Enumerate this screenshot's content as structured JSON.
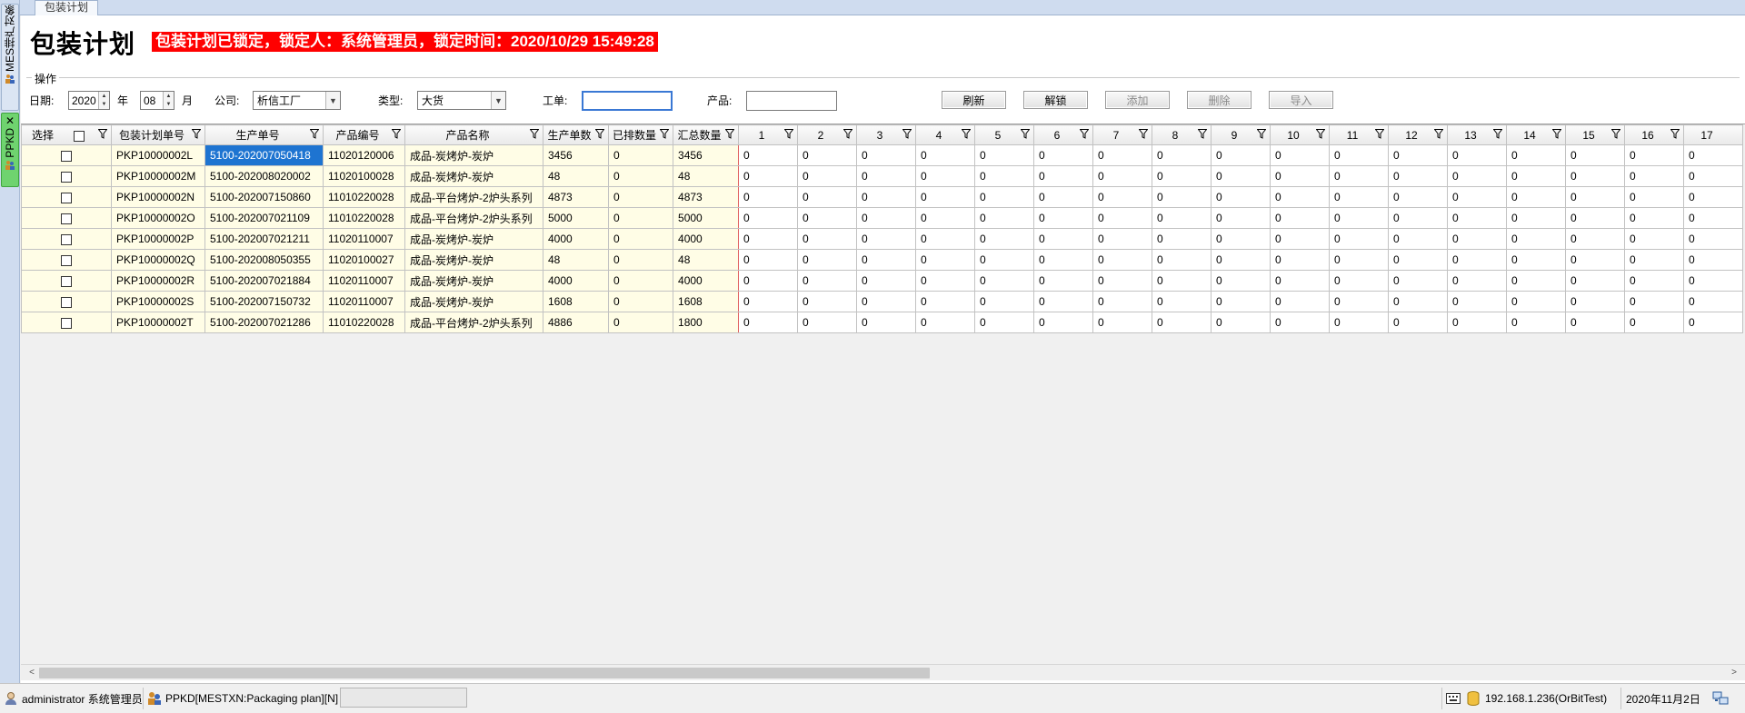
{
  "window": {
    "doc_tab": "包装计划",
    "left_tabs": [
      "MES排产对象",
      "PPKD"
    ]
  },
  "header": {
    "title": "包装计划",
    "lock_message": "包装计划已锁定，锁定人：系统管理员，锁定时间：2020/10/29 15:49:28"
  },
  "ops": {
    "group_label": "操作",
    "date_label": "日期:",
    "year_value": "2020",
    "year_unit": "年",
    "month_value": "08",
    "month_unit": "月",
    "company_label": "公司:",
    "company_value": "析信工厂",
    "type_label": "类型:",
    "type_value": "大货",
    "workorder_label": "工单:",
    "workorder_value": "",
    "product_label": "产品:",
    "product_value": "",
    "buttons": {
      "refresh": "刷新",
      "unlock": "解锁",
      "add": "添加",
      "delete": "删除",
      "import": "导入"
    }
  },
  "grid": {
    "columns": [
      "选择",
      "包装计划单号",
      "生产单号",
      "产品编号",
      "产品名称",
      "生产单数",
      "已排数量",
      "汇总数量",
      "1",
      "2",
      "3",
      "4",
      "5",
      "6",
      "7",
      "8",
      "9",
      "10",
      "11",
      "12",
      "13",
      "14",
      "15",
      "16",
      "17"
    ],
    "rows": [
      {
        "plan": "PKP10000002L",
        "order": "5100-202007050418",
        "code": "11020120006",
        "name": "成品-炭烤炉-炭炉",
        "qty": "3456",
        "scheduled": "0",
        "total": "3456",
        "days": [
          "0",
          "0",
          "0",
          "0",
          "0",
          "0",
          "0",
          "0",
          "0",
          "0",
          "0",
          "0",
          "0",
          "0",
          "0",
          "0",
          "0"
        ]
      },
      {
        "plan": "PKP10000002M",
        "order": "5100-202008020002",
        "code": "11020100028",
        "name": "成品-炭烤炉-炭炉",
        "qty": "48",
        "scheduled": "0",
        "total": "48",
        "days": [
          "0",
          "0",
          "0",
          "0",
          "0",
          "0",
          "0",
          "0",
          "0",
          "0",
          "0",
          "0",
          "0",
          "0",
          "0",
          "0",
          "0"
        ]
      },
      {
        "plan": "PKP10000002N",
        "order": "5100-202007150860",
        "code": "11010220028",
        "name": "成品-平台烤炉-2炉头系列",
        "qty": "4873",
        "scheduled": "0",
        "total": "4873",
        "days": [
          "0",
          "0",
          "0",
          "0",
          "0",
          "0",
          "0",
          "0",
          "0",
          "0",
          "0",
          "0",
          "0",
          "0",
          "0",
          "0",
          "0"
        ]
      },
      {
        "plan": "PKP10000002O",
        "order": "5100-202007021109",
        "code": "11010220028",
        "name": "成品-平台烤炉-2炉头系列",
        "qty": "5000",
        "scheduled": "0",
        "total": "5000",
        "days": [
          "0",
          "0",
          "0",
          "0",
          "0",
          "0",
          "0",
          "0",
          "0",
          "0",
          "0",
          "0",
          "0",
          "0",
          "0",
          "0",
          "0"
        ]
      },
      {
        "plan": "PKP10000002P",
        "order": "5100-202007021211",
        "code": "11020110007",
        "name": "成品-炭烤炉-炭炉",
        "qty": "4000",
        "scheduled": "0",
        "total": "4000",
        "days": [
          "0",
          "0",
          "0",
          "0",
          "0",
          "0",
          "0",
          "0",
          "0",
          "0",
          "0",
          "0",
          "0",
          "0",
          "0",
          "0",
          "0"
        ]
      },
      {
        "plan": "PKP10000002Q",
        "order": "5100-202008050355",
        "code": "11020100027",
        "name": "成品-炭烤炉-炭炉",
        "qty": "48",
        "scheduled": "0",
        "total": "48",
        "days": [
          "0",
          "0",
          "0",
          "0",
          "0",
          "0",
          "0",
          "0",
          "0",
          "0",
          "0",
          "0",
          "0",
          "0",
          "0",
          "0",
          "0"
        ]
      },
      {
        "plan": "PKP10000002R",
        "order": "5100-202007021884",
        "code": "11020110007",
        "name": "成品-炭烤炉-炭炉",
        "qty": "4000",
        "scheduled": "0",
        "total": "4000",
        "days": [
          "0",
          "0",
          "0",
          "0",
          "0",
          "0",
          "0",
          "0",
          "0",
          "0",
          "0",
          "0",
          "0",
          "0",
          "0",
          "0",
          "0"
        ]
      },
      {
        "plan": "PKP10000002S",
        "order": "5100-202007150732",
        "code": "11020110007",
        "name": "成品-炭烤炉-炭炉",
        "qty": "1608",
        "scheduled": "0",
        "total": "1608",
        "days": [
          "0",
          "0",
          "0",
          "0",
          "0",
          "0",
          "0",
          "0",
          "0",
          "0",
          "0",
          "0",
          "0",
          "0",
          "0",
          "0",
          "0"
        ]
      },
      {
        "plan": "PKP10000002T",
        "order": "5100-202007021286",
        "code": "11010220028",
        "name": "成品-平台烤炉-2炉头系列",
        "qty": "4886",
        "scheduled": "0",
        "total": "1800",
        "days": [
          "0",
          "0",
          "0",
          "0",
          "0",
          "0",
          "0",
          "0",
          "0",
          "0",
          "0",
          "0",
          "0",
          "0",
          "0",
          "0",
          "0"
        ]
      }
    ]
  },
  "status": {
    "user": "administrator 系统管理员",
    "module": "PPKD[MESTXN:Packaging plan][N]",
    "server": "192.168.1.236(OrBitTest)",
    "date": "2020年11月2日"
  }
}
